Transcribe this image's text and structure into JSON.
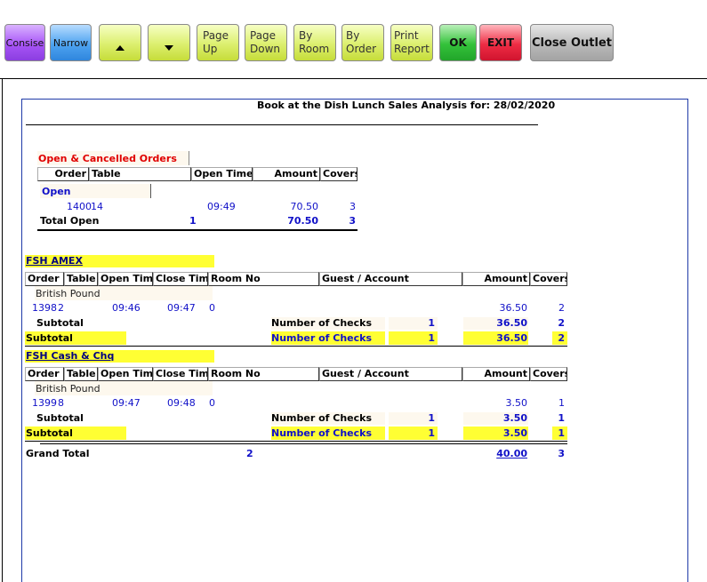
{
  "toolbar": {
    "consise": "Consise",
    "narrow": "Narrow",
    "up_icon": "arrow-up",
    "down_icon": "arrow-down",
    "page_up_1": "Page",
    "page_up_2": "Up",
    "page_down_1": "Page",
    "page_down_2": "Down",
    "by_room_1": "By",
    "by_room_2": "Room",
    "by_order_1": "By",
    "by_order_2": "Order",
    "print_report_1": "Print",
    "print_report_2": "Report",
    "ok": "OK",
    "exit": "EXIT",
    "close_outlet": "Close Outlet"
  },
  "report": {
    "title": "Book at the Dish Lunch Sales Analysis for: 28/02/2020",
    "open_cancelled": {
      "heading": "Open & Cancelled Orders",
      "col_order": "Order",
      "col_table": "Table",
      "col_open_time": "Open Time",
      "col_amount": "Amount",
      "col_covers": "Covers",
      "group_label": "Open",
      "row": {
        "order": "1400",
        "table": "14",
        "open_time": "09:49",
        "amount": "70.50",
        "covers": "3"
      },
      "total_label": "Total Open",
      "total_count": "1",
      "total_amount": "70.50",
      "total_covers": "3"
    },
    "sections": [
      {
        "name": "FSH AMEX",
        "col_order": "Order",
        "col_table": "Table",
        "col_open_time": "Open Time",
        "col_close_time": "Close Time",
        "col_room_no": "Room No",
        "col_guest": "Guest / Account",
        "col_amount": "Amount",
        "col_covers": "Covers",
        "currency": "British Pound",
        "row": {
          "order": "1398",
          "table": "2",
          "open_time": "09:46",
          "close_time": "09:47",
          "room_no": "0",
          "amount": "36.50",
          "covers": "2"
        },
        "subtotal_label": "Subtotal",
        "checks_label": "Number of Checks",
        "checks": "1",
        "sub_amount": "36.50",
        "sub_covers": "2"
      },
      {
        "name": "FSH Cash & Chq",
        "col_order": "Order",
        "col_table": "Table",
        "col_open_time": "Open Time",
        "col_close_time": "Close Time",
        "col_room_no": "Room No",
        "col_guest": "Guest / Account",
        "col_amount": "Amount",
        "col_covers": "Covers",
        "currency": "British Pound",
        "row": {
          "order": "1399",
          "table": "8",
          "open_time": "09:47",
          "close_time": "09:48",
          "room_no": "0",
          "amount": "3.50",
          "covers": "1"
        },
        "subtotal_label": "Subtotal",
        "checks_label": "Number of Checks",
        "checks": "1",
        "sub_amount": "3.50",
        "sub_covers": "1"
      }
    ],
    "grand_total": {
      "label": "Grand Total",
      "count": "2",
      "amount": "40.00",
      "covers": "3"
    }
  },
  "colors": {
    "highlight": "#ffff33",
    "blue_text": "#1010c8",
    "red_text": "#e00000",
    "border": "#1f3aa8"
  }
}
